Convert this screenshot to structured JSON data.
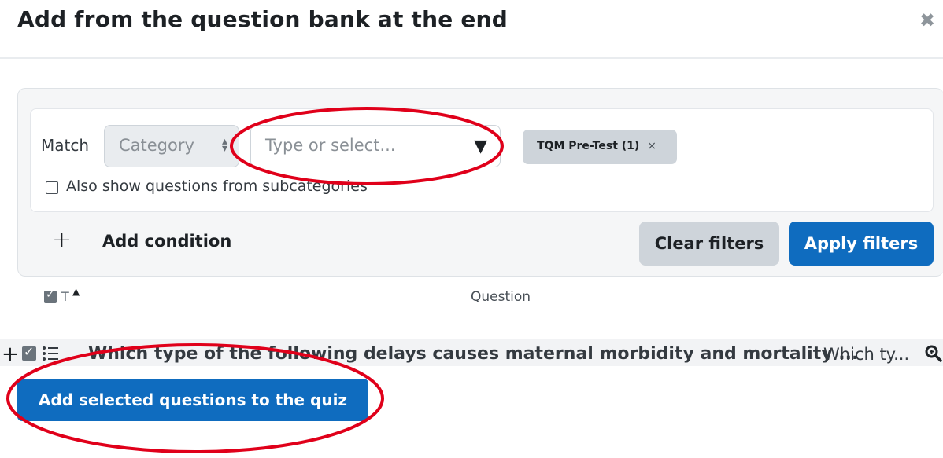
{
  "modal": {
    "title": "Add from the question bank at the end",
    "close_symbol": "✖"
  },
  "filters": {
    "match_label": "Match",
    "condition_field": "Category",
    "value_placeholder": "Type or select...",
    "selected_tag": "TQM Pre-Test (1)",
    "tag_remove_symbol": "×",
    "subcategories_label": "Also show questions from subcategories",
    "subcategories_checked": false,
    "add_condition_label": "Add condition",
    "clear_label": "Clear filters",
    "apply_label": "Apply filters"
  },
  "table": {
    "type_header": "T",
    "question_header": "Question",
    "rows": [
      {
        "question_name": "Which type of the following delays causes maternal morbidity and mortality ...",
        "question_text": "Which ty...",
        "checked": true
      }
    ]
  },
  "actions": {
    "add_selected_label": "Add selected questions to the quiz"
  },
  "colors": {
    "primary": "#0f6cbf",
    "secondary": "#ced4da",
    "annotation": "#e0001a"
  },
  "icons": {
    "close": "close-icon",
    "add_condition": "plus-icon",
    "dropdown": "caret-down-icon",
    "type": "multichoice-icon",
    "preview": "magnifier-icon"
  }
}
